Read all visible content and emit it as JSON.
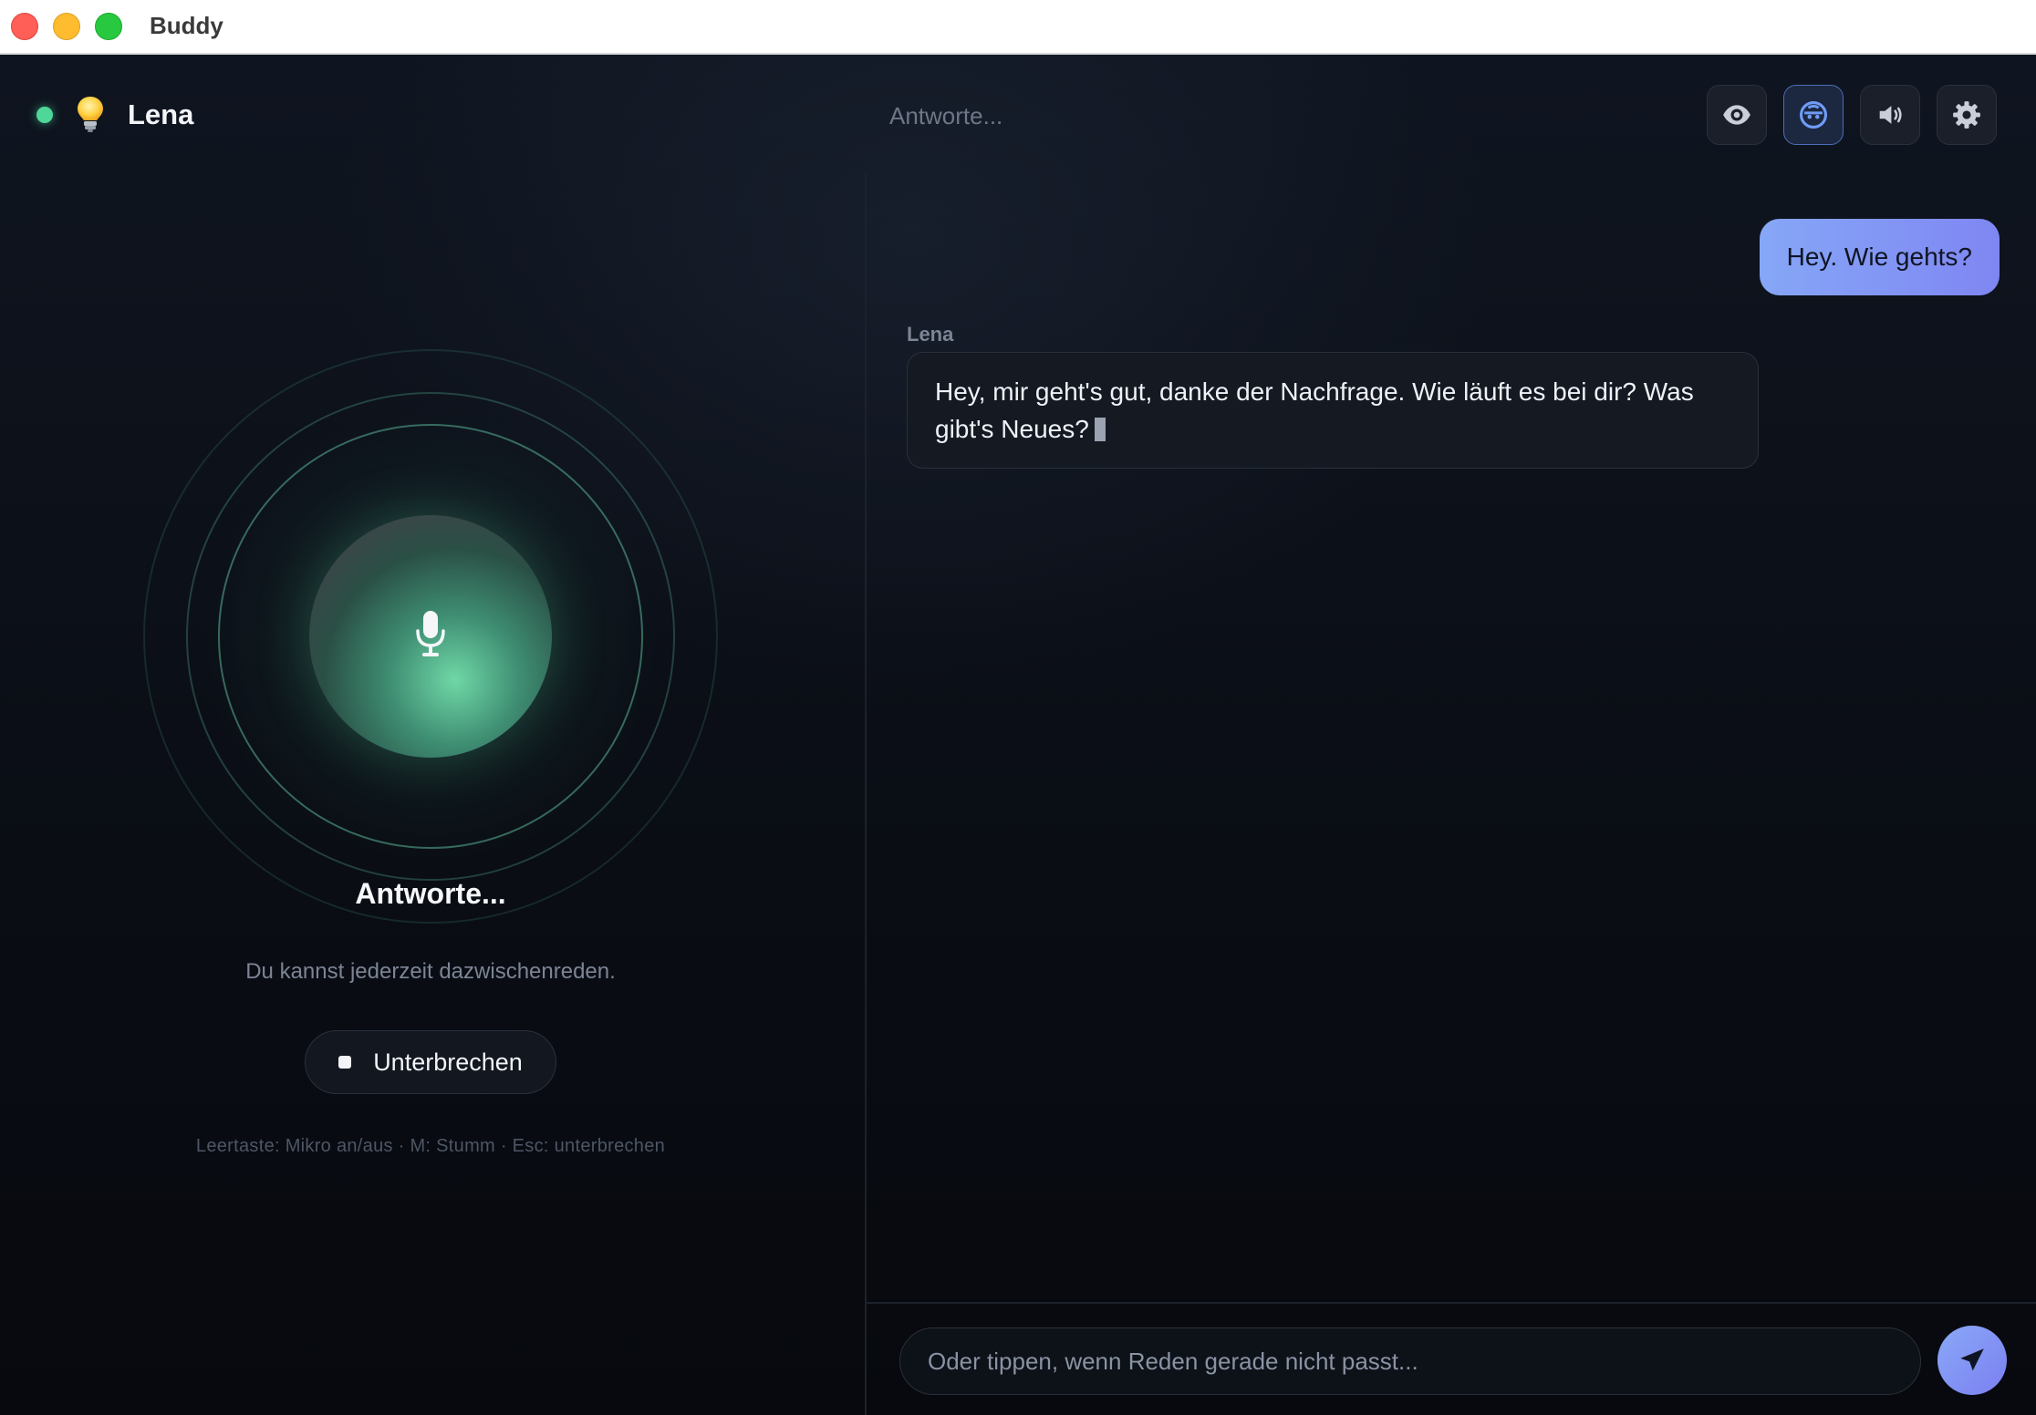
{
  "window": {
    "title": "Buddy"
  },
  "header": {
    "agent_name": "Lena",
    "status_text": "Antworte...",
    "buttons": [
      {
        "name": "eye",
        "icon": "eye-icon"
      },
      {
        "name": "face-sync",
        "icon": "face-icon",
        "active": true
      },
      {
        "name": "volume",
        "icon": "volume-icon"
      },
      {
        "name": "settings",
        "icon": "gear-icon"
      }
    ]
  },
  "voice_panel": {
    "status": "Antworte...",
    "hint": "Du kannst jederzeit dazwischenreden.",
    "interrupt_label": "Unterbrechen",
    "shortcuts": "Leertaste: Mikro an/aus · M: Stumm · Esc: unterbrechen"
  },
  "chat": {
    "messages": [
      {
        "role": "user",
        "text": "Hey. Wie gehts?"
      },
      {
        "role": "assistant",
        "sender": "Lena",
        "text": "Hey, mir geht's gut, danke der Nachfrage. Wie läuft es bei dir? Was gibt's Neues?"
      }
    ],
    "input_placeholder": "Oder tippen, wenn Reden gerade nicht passt..."
  },
  "colors": {
    "accent_green": "#4fd79a",
    "accent_blue": "#86a7f7",
    "background": "#0b0f17"
  }
}
